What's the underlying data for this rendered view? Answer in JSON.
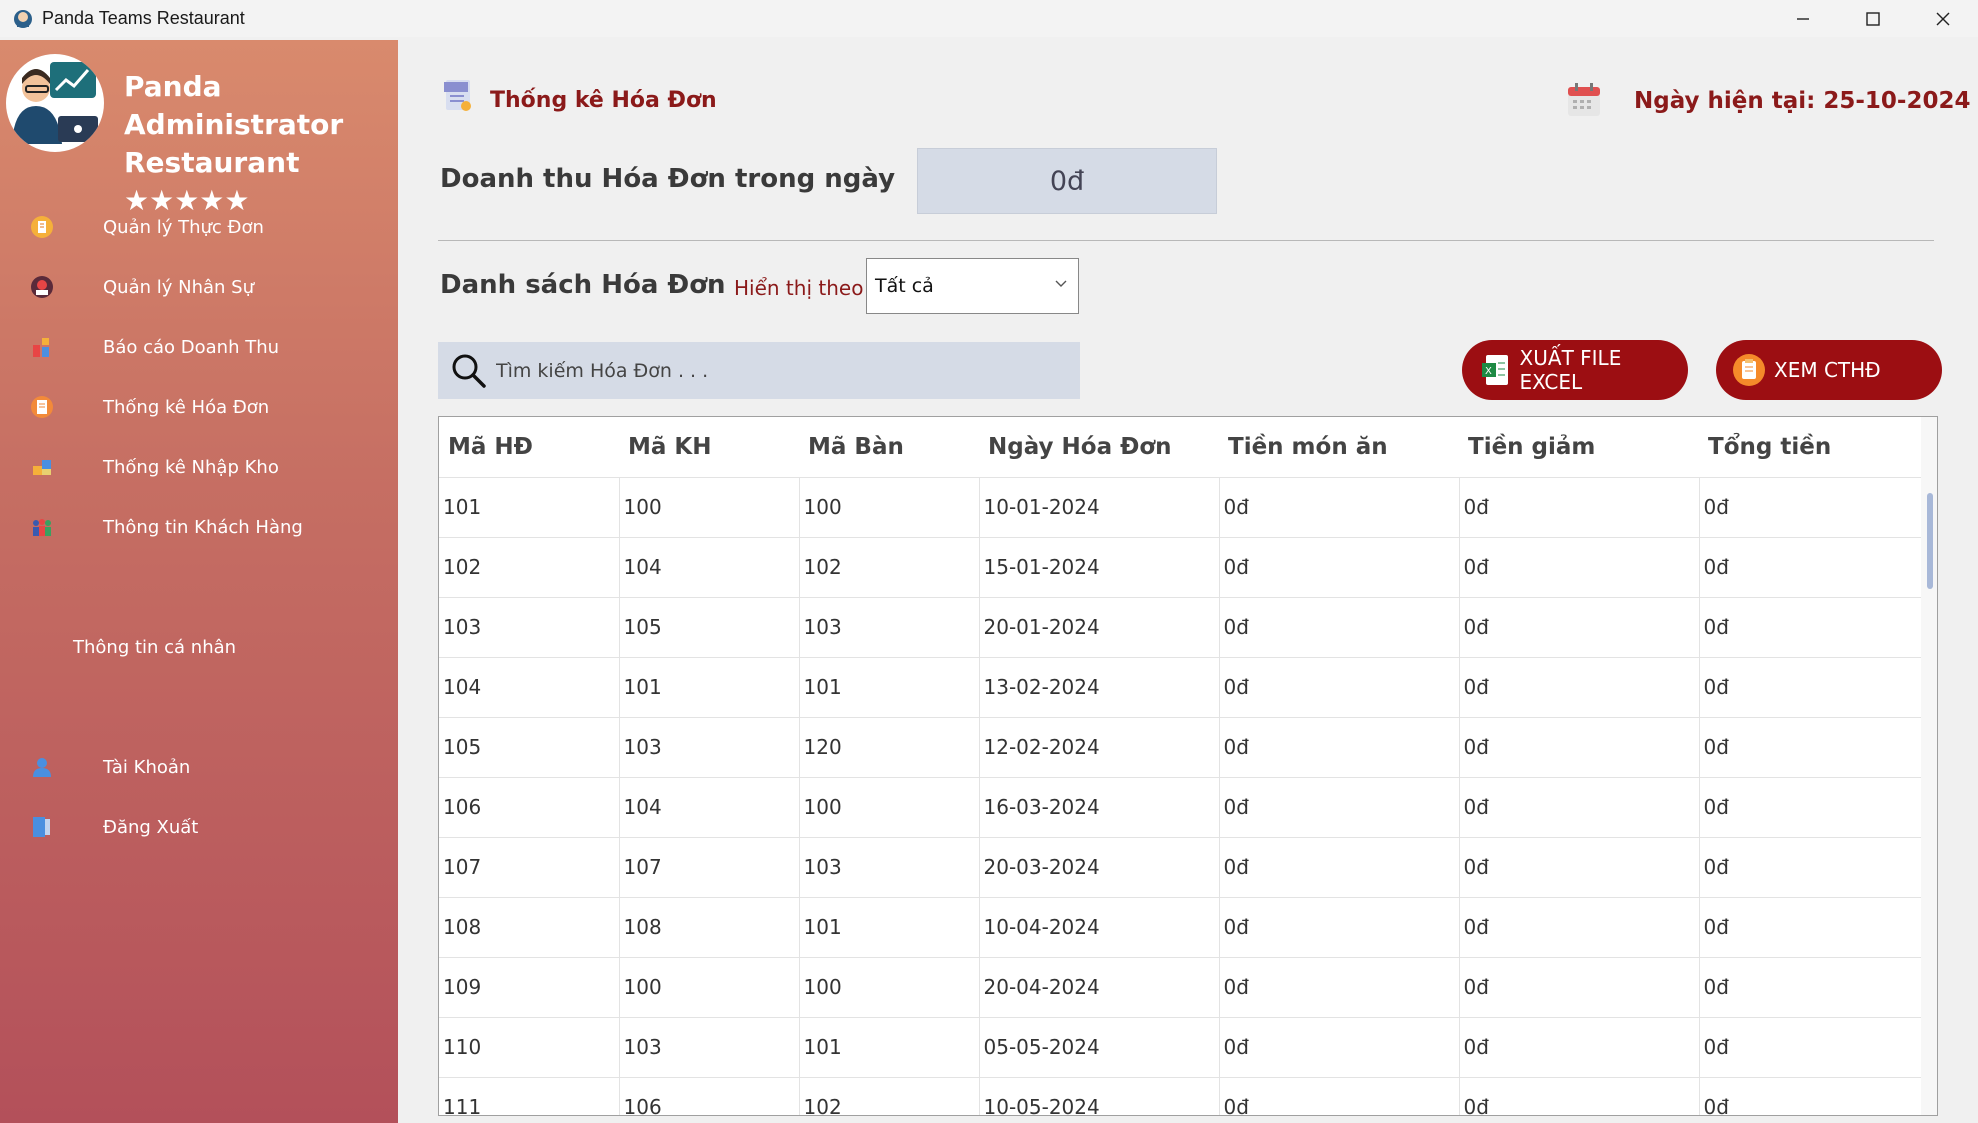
{
  "window": {
    "title": "Panda Teams Restaurant"
  },
  "sidebar": {
    "brand_line1": "Panda Administrator",
    "brand_line2": "Restaurant ★★★★★",
    "items": [
      {
        "label": "Quản lý Thực Đơn",
        "icon": "menu-icon"
      },
      {
        "label": "Quản lý Nhân Sự",
        "icon": "staff-icon"
      },
      {
        "label": "Báo cáo Doanh Thu",
        "icon": "revenue-icon"
      },
      {
        "label": "Thống kê Hóa Đơn",
        "icon": "invoice-icon"
      },
      {
        "label": "Thống kê Nhập Kho",
        "icon": "warehouse-icon"
      },
      {
        "label": "Thông tin Khách Hàng",
        "icon": "customers-icon"
      }
    ],
    "personal_section": "Thông tin cá nhân",
    "account": "Tài Khoản",
    "logout": "Đăng Xuất"
  },
  "header": {
    "page_title": "Thống kê Hóa Đơn",
    "date_label": "Ngày hiện tại: 25-10-2024"
  },
  "revenue": {
    "label": "Doanh thu Hóa Đơn trong ngày",
    "value": "0đ"
  },
  "list": {
    "label": "Danh sách Hóa Đơn",
    "filter_label": "Hiển thị theo",
    "filter_value": "Tất cả",
    "search_placeholder": "Tìm kiếm Hóa Đơn . . .",
    "export_button": "XUẤT FILE EXCEL",
    "detail_button": "XEM CTHĐ"
  },
  "table": {
    "columns": [
      "Mã HĐ",
      "Mã KH",
      "Mã Bàn",
      "Ngày Hóa Đơn",
      "Tiền món ăn",
      "Tiền giảm",
      "Tổng tiền"
    ],
    "rows": [
      [
        "101",
        "100",
        "100",
        "10-01-2024",
        "0đ",
        "0đ",
        "0đ"
      ],
      [
        "102",
        "104",
        "102",
        "15-01-2024",
        "0đ",
        "0đ",
        "0đ"
      ],
      [
        "103",
        "105",
        "103",
        "20-01-2024",
        "0đ",
        "0đ",
        "0đ"
      ],
      [
        "104",
        "101",
        "101",
        "13-02-2024",
        "0đ",
        "0đ",
        "0đ"
      ],
      [
        "105",
        "103",
        "120",
        "12-02-2024",
        "0đ",
        "0đ",
        "0đ"
      ],
      [
        "106",
        "104",
        "100",
        "16-03-2024",
        "0đ",
        "0đ",
        "0đ"
      ],
      [
        "107",
        "107",
        "103",
        "20-03-2024",
        "0đ",
        "0đ",
        "0đ"
      ],
      [
        "108",
        "108",
        "101",
        "10-04-2024",
        "0đ",
        "0đ",
        "0đ"
      ],
      [
        "109",
        "100",
        "100",
        "20-04-2024",
        "0đ",
        "0đ",
        "0đ"
      ],
      [
        "110",
        "103",
        "101",
        "05-05-2024",
        "0đ",
        "0đ",
        "0đ"
      ],
      [
        "111",
        "106",
        "102",
        "10-05-2024",
        "0đ",
        "0đ",
        "0đ"
      ]
    ]
  },
  "colors": {
    "accent": "#8b1a1a",
    "button": "#9c0e12",
    "sidebar_top": "#d98a6d",
    "sidebar_bottom": "#b3505a"
  }
}
